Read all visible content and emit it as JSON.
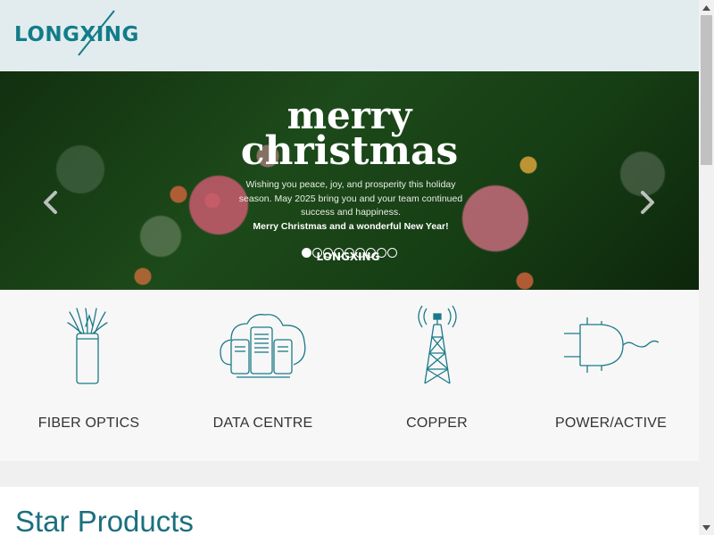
{
  "header": {
    "logo": {
      "text": "LONGXING",
      "icon": "longxing-logo"
    }
  },
  "banner": {
    "title_line1": "merry",
    "title_line2": "christmas",
    "message": "Wishing you peace, joy, and prosperity this holiday season. May 2025 bring you and your team continued success and happiness.",
    "message_strong": "Merry Christmas and a wonderful New Year!",
    "logo_text": "LONGXING",
    "prev_icon": "chevron-left-icon",
    "next_icon": "chevron-right-icon",
    "slide_count": 9,
    "active_slide": 1
  },
  "categories": [
    {
      "label": "FIBER OPTICS",
      "icon": "fiber-optics-icon"
    },
    {
      "label": "DATA CENTRE",
      "icon": "data-centre-icon"
    },
    {
      "label": "COPPER",
      "icon": "copper-tower-icon"
    },
    {
      "label": "POWER/ACTIVE",
      "icon": "power-plug-icon"
    }
  ],
  "star_products": {
    "title": "Star Products"
  },
  "colors": {
    "brand": "#127c8a",
    "header_bg": "#e2ecee",
    "icon_stroke": "#1b7a88",
    "heading": "#1b6f7e"
  }
}
